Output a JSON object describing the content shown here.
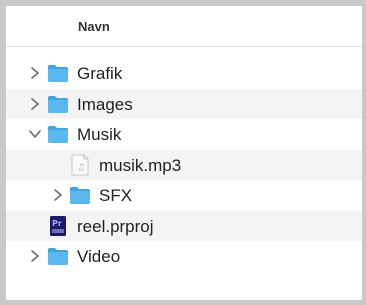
{
  "header": {
    "column_title": "Navn"
  },
  "rows": [
    {
      "label": "Grafik",
      "type": "folder",
      "expanded": false,
      "depth": 0
    },
    {
      "label": "Images",
      "type": "folder",
      "expanded": false,
      "depth": 0
    },
    {
      "label": "Musik",
      "type": "folder",
      "expanded": true,
      "depth": 0
    },
    {
      "label": "musik.mp3",
      "type": "audio-file",
      "depth": 1
    },
    {
      "label": "SFX",
      "type": "folder",
      "expanded": false,
      "depth": 1
    },
    {
      "label": "reel.prproj",
      "type": "premiere-project",
      "depth": 0,
      "icon_text": "Pr"
    },
    {
      "label": "Video",
      "type": "folder",
      "expanded": false,
      "depth": 0
    }
  ],
  "colors": {
    "folder": "#5ab8ee",
    "folder_tab": "#3fa4e0",
    "premiere_bg": "#1a1a66",
    "premiere_text": "#a9a9ff",
    "stripe": "#f4f4f4"
  }
}
